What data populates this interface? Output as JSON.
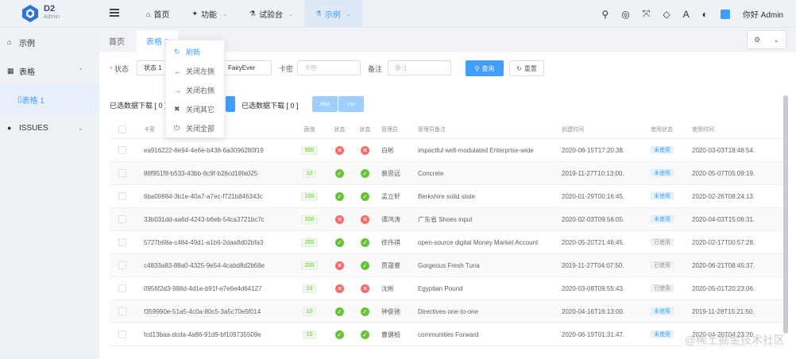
{
  "app": {
    "logo_text": "D2",
    "logo_sub": "Admin"
  },
  "header": {
    "nav": [
      {
        "label": "首页",
        "icon": "home-icon",
        "caret": false
      },
      {
        "label": "功能",
        "icon": "puzzle-icon",
        "caret": true
      },
      {
        "label": "试验台",
        "icon": "flask-icon",
        "caret": true
      },
      {
        "label": "示例",
        "icon": "flask-icon",
        "caret": true,
        "active": true
      }
    ],
    "greeting": "你好 Admin"
  },
  "sidebar": {
    "items": [
      {
        "label": "示例",
        "icon": "home-icon"
      },
      {
        "label": "表格",
        "icon": "table-icon",
        "expanded": true
      },
      {
        "label": "表格 1",
        "icon": "file-icon",
        "sub": true
      },
      {
        "label": "ISSUES",
        "icon": "github-icon",
        "expanded": false
      }
    ]
  },
  "tabs": [
    {
      "label": "首页"
    },
    {
      "label": "表格 1"
    }
  ],
  "context_menu": {
    "items": [
      {
        "label": "刷新",
        "icon": "refresh-icon"
      },
      {
        "label": "关闭左侧",
        "icon": "arrow-left-icon"
      },
      {
        "label": "关闭右侧",
        "icon": "arrow-right-icon"
      },
      {
        "label": "关闭其它",
        "icon": "close-icon"
      },
      {
        "label": "关闭全部",
        "icon": "power-icon"
      }
    ]
  },
  "form": {
    "status_label": "状态",
    "status_value": "状态 1",
    "user_value": "FairyEver",
    "card_label": "卡密",
    "card_placeholder": "卡密",
    "note_label": "备注",
    "note_placeholder": "备注",
    "query_label": "查询",
    "reset_label": "重置"
  },
  "download": {
    "text1": "已选数据下载 [ 0 ]",
    "text2": "已选数据下载 [ 0 ]",
    "btn_xlsx": "xlsx",
    "btn_csv": "csv"
  },
  "table": {
    "headers": [
      "卡密",
      "面值",
      "状态",
      "状态",
      "管理员",
      "管理员备注",
      "创建时间",
      "使用状态",
      "使用时间"
    ],
    "rows": [
      {
        "card": "ea916222-8e94-4e6e-b438-6a3096280f19",
        "value": "500",
        "s1": false,
        "s2": false,
        "admin": "白彬",
        "note": "impactful well-modulated Enterprise-wide",
        "created": "2020-08-15T17:20:38.",
        "use": "未使用",
        "used_at": "2020-03-03T18:48:54."
      },
      {
        "card": "88f951f8-b533-43bb-8c9f-b26cd18fa025",
        "value": "10",
        "s1": true,
        "s2": true,
        "admin": "裴思远",
        "note": "Concrete",
        "created": "2019-11-27T10:13:00.",
        "use": "未使用",
        "used_at": "2020-05-07T05:09:19."
      },
      {
        "card": "6ba09884-3b1e-40a7-a7ec-f721b846343c",
        "value": "100",
        "s1": true,
        "s2": true,
        "admin": "孟立轩",
        "note": "Berkshire solid state",
        "created": "2020-01-29T00:16:45.",
        "use": "未使用",
        "used_at": "2020-02-26T08:24:13."
      },
      {
        "card": "33b031dd-aa6d-4243-b6eb-54ca3721bc7c",
        "value": "200",
        "s1": false,
        "s2": false,
        "admin": "谭鸿涛",
        "note": "广东省 Shoes input",
        "created": "2020-02-03T09:56:05.",
        "use": "未使用",
        "used_at": "2020-04-03T15:06:31."
      },
      {
        "card": "5727b68a-c484-49d1-a1b9-2daa8d02bfa3",
        "value": "200",
        "s1": true,
        "s2": true,
        "admin": "徐伟祺",
        "note": "open-source digital Money Market Account",
        "created": "2020-05-20T21:46:45.",
        "use": "已使用",
        "used_at": "2020-02-17T00:57:28."
      },
      {
        "card": "c4833a83-88a0-4325-9e54-4cabd8d2b68e",
        "value": "200",
        "s1": false,
        "s2": true,
        "admin": "贾晟睿",
        "note": "Gorgeous Fresh Tuna",
        "created": "2019-11-27T04:07:50.",
        "use": "已使用",
        "used_at": "2020-06-21T08:45:37."
      },
      {
        "card": "0956f2d3-988d-4d1e-b91f-e7e6e4d64127",
        "value": "10",
        "s1": false,
        "s2": false,
        "admin": "沈彬",
        "note": "Egyptian Pound",
        "created": "2020-03-08T09:55:43.",
        "use": "已使用",
        "used_at": "2020-05-01T20:23:06."
      },
      {
        "card": "f359990e-51a5-4c0a-80c5-3a5c70e5f014",
        "value": "10",
        "s1": true,
        "s2": true,
        "admin": "钟俊驰",
        "note": "Directives one-to-one",
        "created": "2020-04-16T16:13:00.",
        "use": "未使用",
        "used_at": "2019-11-28T15:21:50."
      },
      {
        "card": "fcd13baa-dcda-4a86-91d9-bf109735509e",
        "value": "10",
        "s1": true,
        "s2": true,
        "admin": "曹健柏",
        "note": "communities Forward",
        "created": "2020-06-19T01:31:47.",
        "use": "未使用",
        "used_at": "2020-04-20T04:23:20."
      }
    ]
  },
  "watermark": "@稀土掘金技术社区",
  "colors": {
    "primary": "#409eff",
    "success": "#67c23a",
    "danger": "#f56c6c"
  }
}
